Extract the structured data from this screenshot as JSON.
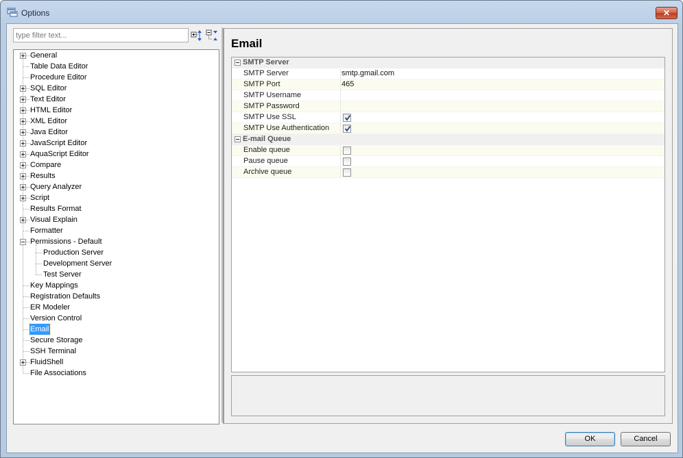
{
  "window": {
    "title": "Options",
    "close_glyph": "✕"
  },
  "filter": {
    "placeholder": "type filter text..."
  },
  "tree": {
    "items": [
      {
        "label": "General",
        "expander": "plus"
      },
      {
        "label": "Table Data Editor",
        "expander": "none"
      },
      {
        "label": "Procedure Editor",
        "expander": "none"
      },
      {
        "label": "SQL Editor",
        "expander": "plus"
      },
      {
        "label": "Text Editor",
        "expander": "plus"
      },
      {
        "label": "HTML Editor",
        "expander": "plus"
      },
      {
        "label": "XML Editor",
        "expander": "plus"
      },
      {
        "label": "Java Editor",
        "expander": "plus"
      },
      {
        "label": "JavaScript Editor",
        "expander": "plus"
      },
      {
        "label": "AquaScript Editor",
        "expander": "plus"
      },
      {
        "label": "Compare",
        "expander": "plus"
      },
      {
        "label": "Results",
        "expander": "plus"
      },
      {
        "label": "Query Analyzer",
        "expander": "plus"
      },
      {
        "label": "Script",
        "expander": "plus"
      },
      {
        "label": "Results Format",
        "expander": "none"
      },
      {
        "label": "Visual Explain",
        "expander": "plus"
      },
      {
        "label": "Formatter",
        "expander": "none"
      },
      {
        "label": "Permissions - Default",
        "expander": "minus"
      },
      {
        "label": "Production Server",
        "expander": "child"
      },
      {
        "label": "Development Server",
        "expander": "child"
      },
      {
        "label": "Test Server",
        "expander": "child"
      },
      {
        "label": "Key Mappings",
        "expander": "none"
      },
      {
        "label": "Registration Defaults",
        "expander": "none"
      },
      {
        "label": "ER Modeler",
        "expander": "none"
      },
      {
        "label": "Version Control",
        "expander": "none"
      },
      {
        "label": "Email",
        "expander": "none",
        "selected": true
      },
      {
        "label": "Secure Storage",
        "expander": "none"
      },
      {
        "label": "SSH Terminal",
        "expander": "none"
      },
      {
        "label": "FluidShell",
        "expander": "plus"
      },
      {
        "label": "File Associations",
        "expander": "none"
      }
    ]
  },
  "page": {
    "title": "Email"
  },
  "properties": {
    "smtp": {
      "category": "SMTP Server",
      "server_name": "SMTP Server",
      "server_value": "smtp.gmail.com",
      "port_name": "SMTP Port",
      "port_value": "465",
      "username_name": "SMTP Username",
      "username_value": "",
      "password_name": "SMTP Password",
      "password_value": "",
      "ssl_name": "SMTP Use SSL",
      "ssl_checked": true,
      "auth_name": "SMTP Use Authentication",
      "auth_checked": true
    },
    "queue": {
      "category": "E-mail Queue",
      "enable_name": "Enable queue",
      "enable_checked": false,
      "pause_name": "Pause queue",
      "pause_checked": false,
      "archive_name": "Archive queue",
      "archive_checked": false
    }
  },
  "buttons": {
    "ok": "OK",
    "cancel": "Cancel"
  },
  "colors": {
    "selection": "#3399ff",
    "close_button": "#cf5f44",
    "checkmark": "#21408a"
  }
}
